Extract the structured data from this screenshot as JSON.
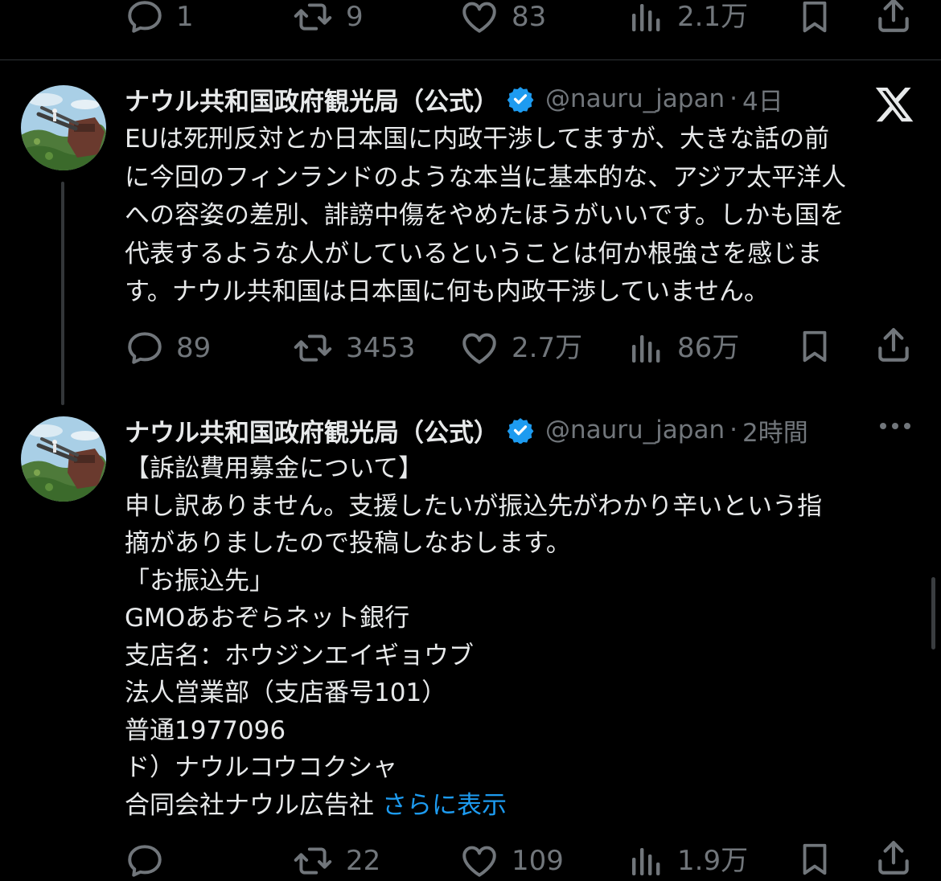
{
  "colors": {
    "background": "#000000",
    "text": "#e7e9ea",
    "muted": "#71767b",
    "link": "#1d9bf0",
    "verified": "#1d9bf0",
    "divider": "#2f3336"
  },
  "top_actions": {
    "reply": "1",
    "retweet": "9",
    "like": "83",
    "views": "2.1万"
  },
  "tweet1": {
    "name": "ナウル共和国政府観光局（公式）",
    "handle": "@nauru_japan",
    "dot": "·",
    "time": "4日",
    "corner_icon": "x-logo-icon",
    "text_lines": [
      "EUは死刑反対とか日本国に内政干渉してますが、大きな話の前",
      "に今回のフィンランドのような本当に基本的な、アジア太平洋人",
      "への容姿の差別、誹謗中傷をやめたほうがいいです。しかも国を",
      "代表するような人がしているということは何か根強さを感じま",
      "す。ナウル共和国は日本国に何も内政干渉していません。"
    ],
    "actions": {
      "reply": "89",
      "retweet": "3453",
      "like": "2.7万",
      "views": "86万"
    }
  },
  "tweet2": {
    "name": "ナウル共和国政府観光局（公式）",
    "handle": "@nauru_japan",
    "dot": "·",
    "time": "2時間",
    "text_lines": [
      "【訴訟費用募金について】",
      "申し訳ありません。支援したいが振込先がわかり辛いという指",
      "摘がありましたので投稿しなおします。",
      "「お振込先」",
      "GMOあおぞらネット銀行",
      "支店名：ホウジンエイギョウブ",
      "法人営業部（支店番号101）",
      "普通1977096",
      "ド）ナウルコウコクシャ",
      "合同会社ナウル広告社"
    ],
    "show_more": "さらに表示",
    "actions": {
      "reply": "",
      "retweet": "22",
      "like": "109",
      "views": "1.9万"
    }
  }
}
